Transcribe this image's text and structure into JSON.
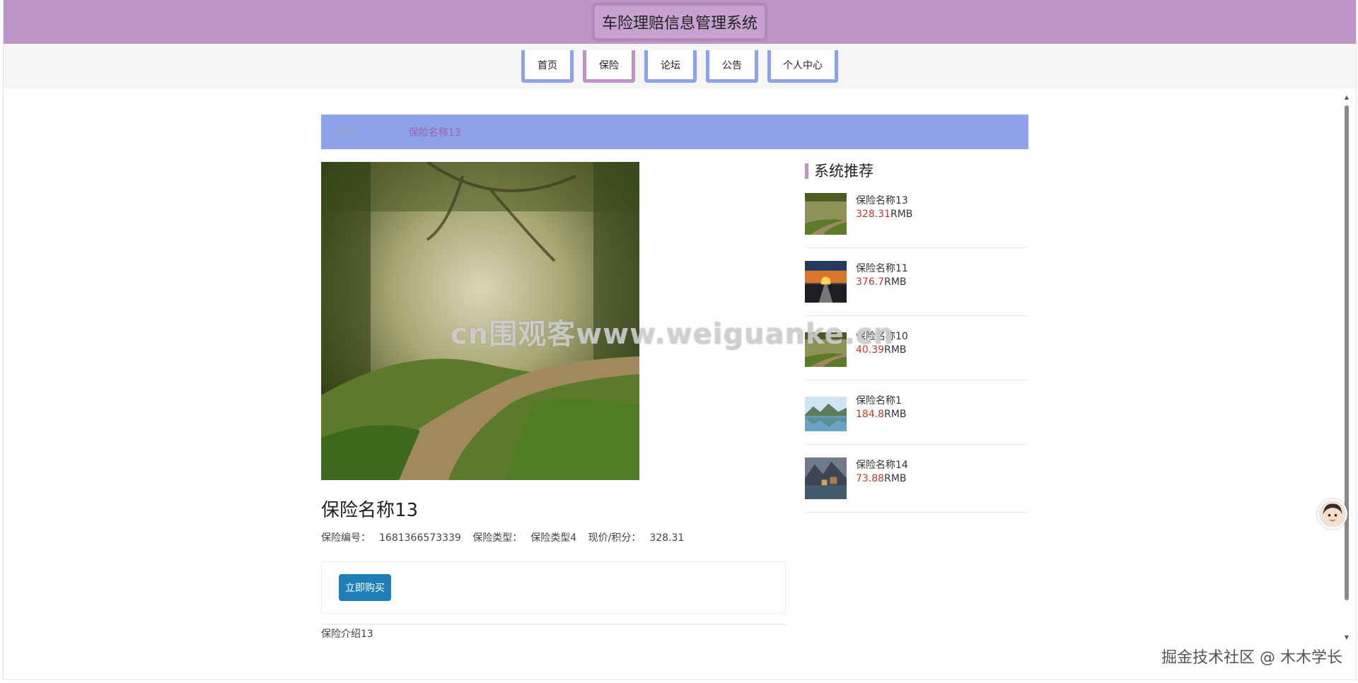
{
  "header": {
    "title": "车险理赔信息管理系统"
  },
  "nav": {
    "items": [
      {
        "label": "首页"
      },
      {
        "label": "保险",
        "active": true
      },
      {
        "label": "论坛"
      },
      {
        "label": "公告"
      },
      {
        "label": "个人中心"
      }
    ]
  },
  "breadcrumb": {
    "home": "首页",
    "separator": "/",
    "current": "保险名称13"
  },
  "product": {
    "image": "forest-path-image",
    "name": "保险名称13",
    "code_label": "保险编号：",
    "code_value": "1681366573339",
    "type_label": "保险类型：",
    "type_value": "保险类型4",
    "price_label": "现价/积分：",
    "price_value": "328.31",
    "buy_label": "立即购买",
    "intro": "保险介绍13"
  },
  "recommend": {
    "title": "系统推荐",
    "items": [
      {
        "name": "保险名称13",
        "price": "328.31",
        "unit": "RMB",
        "image": "forest-path-image"
      },
      {
        "name": "保险名称11",
        "price": "376.7",
        "unit": "RMB",
        "image": "sunset-road-image"
      },
      {
        "name": "保险名称10",
        "price": "40.39",
        "unit": "RMB",
        "image": "forest-path-image"
      },
      {
        "name": "保险名称1",
        "price": "184.8",
        "unit": "RMB",
        "image": "mountain-lake-image"
      },
      {
        "name": "保险名称14",
        "price": "73.88",
        "unit": "RMB",
        "image": "alpine-village-image"
      }
    ]
  },
  "overlays": {
    "watermark": "cn围观客www.weiguanke.cn",
    "credit": "掘金技术社区 @ 木木学长"
  },
  "colors": {
    "header_bg": "#bf94c9",
    "nav_accent": "#8ea2ea",
    "nav_active": "#bf94c9",
    "breadcrumb_bg": "#8ea2ea",
    "price_red": "#c0392b",
    "buy_button": "#1f7fb6"
  }
}
